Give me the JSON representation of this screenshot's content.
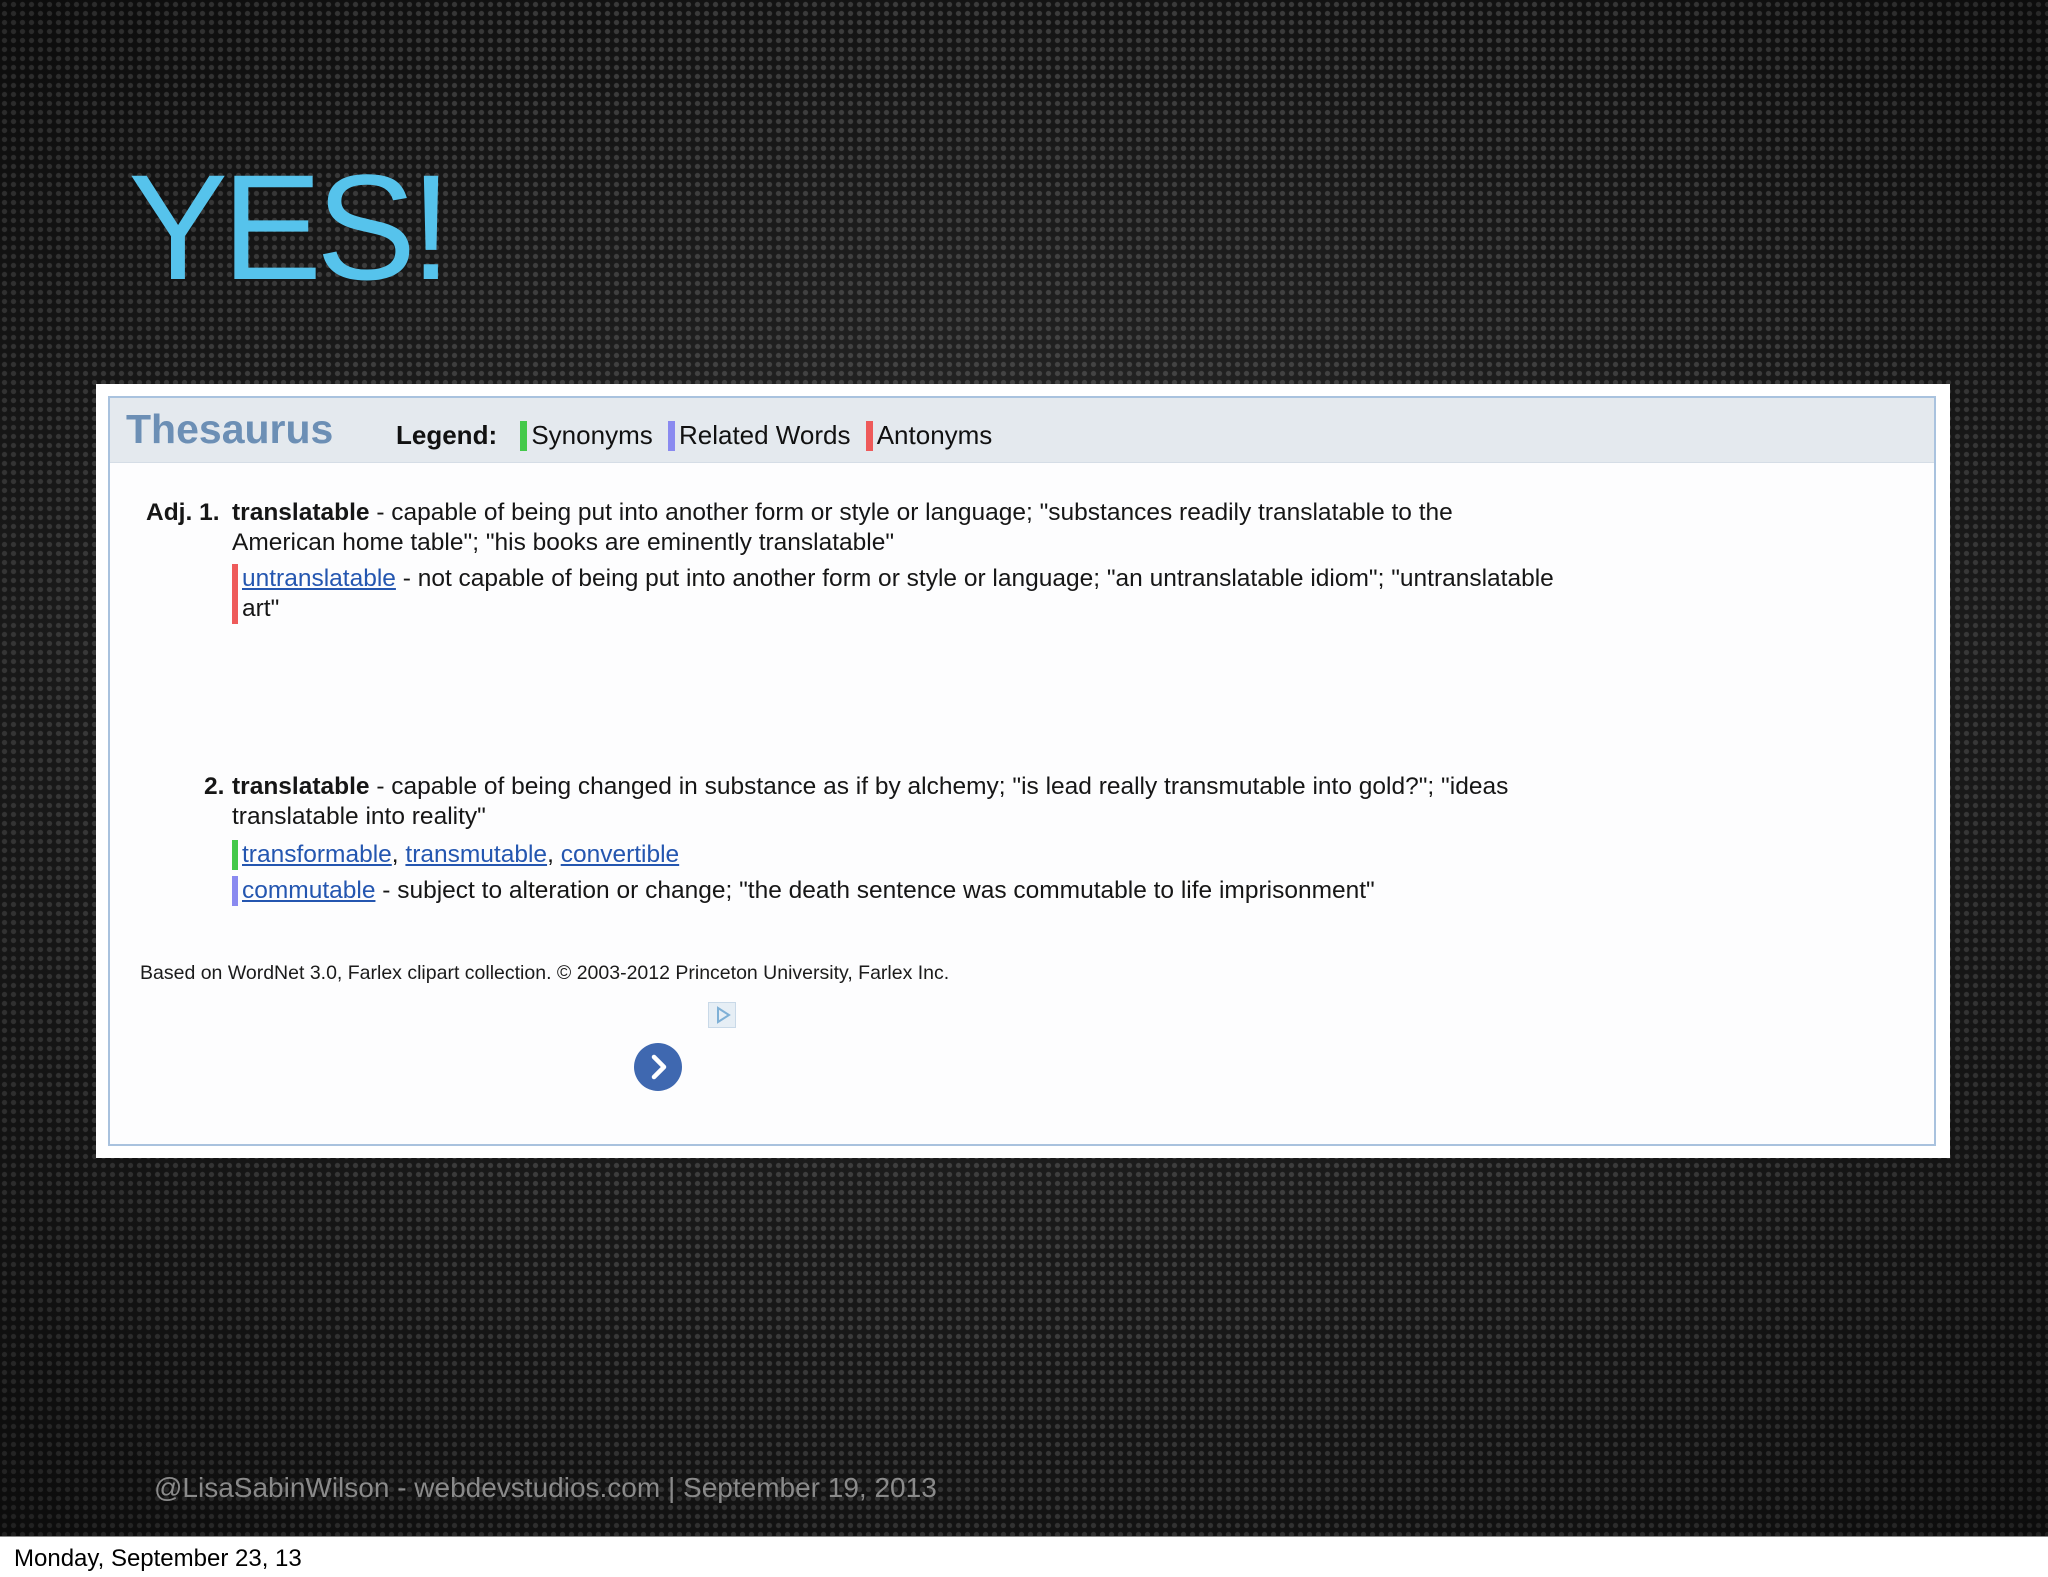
{
  "slide": {
    "title": "YES!",
    "footer_credit": "@LisaSabinWilson - webdevstudios.com | September 19, 2013"
  },
  "thesaurus": {
    "title": "Thesaurus",
    "legend_label": "Legend:",
    "legend": [
      {
        "label": "Synonyms",
        "color": "#43c94a"
      },
      {
        "label": "Related Words",
        "color": "#8a8af0"
      },
      {
        "label": "Antonyms",
        "color": "#ee5a5a"
      }
    ],
    "sense1": {
      "number": "Adj. 1.",
      "headword": "translatable",
      "definition_line1": " - capable of being put into another form or style or language; \"substances readily translatable to the",
      "definition_line2": "American home table\"; \"his books are eminently translatable\"",
      "antonym": {
        "word": "untranslatable",
        "definition_line1": " - not capable of being put into another form or style or language; \"an untranslatable idiom\"; \"untranslatable",
        "definition_line2": "art\""
      }
    },
    "sense2": {
      "number": "2.",
      "headword": "translatable",
      "definition_line1": " - capable of being changed in substance as if by alchemy; \"is lead really transmutable into gold?\"; \"ideas",
      "definition_line2": "translatable into reality\"",
      "synonyms": [
        "transformable",
        "transmutable",
        "convertible"
      ],
      "separator": ", ",
      "related": {
        "word": "commutable",
        "definition": " - subject to alteration or change; \"the death sentence was commutable to life imprisonment\""
      }
    },
    "footer_note": "Based on WordNet 3.0, Farlex clipart collection. © 2003-2012 Princeton University, Farlex Inc."
  },
  "icons": {
    "ad_choices": "ad-choices-icon",
    "next": "chevron-right-icon"
  },
  "status_bar": {
    "date": "Monday, September 23, 13"
  }
}
